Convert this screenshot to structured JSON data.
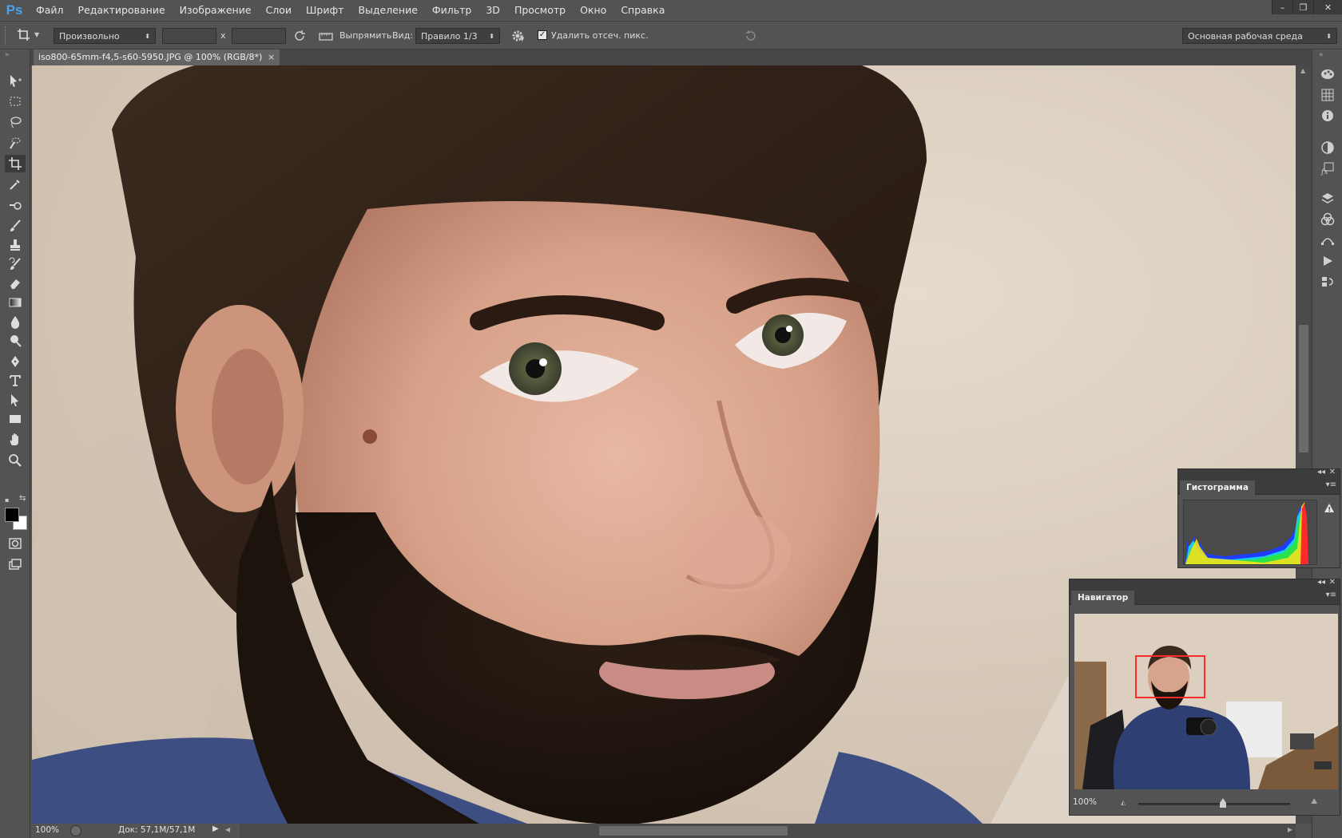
{
  "app": {
    "logo": "Ps"
  },
  "menu": [
    "Файл",
    "Редактирование",
    "Изображение",
    "Слои",
    "Шрифт",
    "Выделение",
    "Фильтр",
    "3D",
    "Просмотр",
    "Окно",
    "Справка"
  ],
  "window_controls": {
    "minimize": "–",
    "restore": "❐",
    "close": "✕"
  },
  "options": {
    "ratio_select": "Произвольно",
    "times": "x",
    "straighten_label": "Выпрямить",
    "view_label": "Вид:",
    "view_select": "Правило 1/3",
    "delete_cropped_label": "Удалить отсеч. пикс.",
    "delete_cropped_checked": "✓",
    "workspace_select": "Основная рабочая среда"
  },
  "document": {
    "tab_title": "iso800-65mm-f4,5-s60-5950.JPG @ 100% (RGB/8*)",
    "tab_close": "×",
    "zoom": "100%",
    "doc_info": "Док: 57,1M/57,1M"
  },
  "histogram": {
    "title": "Гистограмма",
    "warning": "!"
  },
  "navigator": {
    "title": "Навигатор",
    "zoom": "100%",
    "zoom_slider_fraction": 0.56
  },
  "colors": {
    "foreground": "#000000",
    "background": "#ffffff",
    "accent": "#4aa3ef",
    "nav_view_box": "#ff2a2a"
  }
}
